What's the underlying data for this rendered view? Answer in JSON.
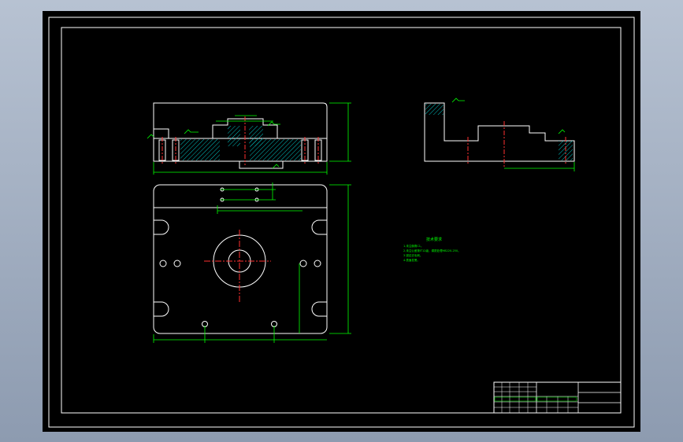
{
  "colors": {
    "background": "#000000",
    "outline": "#ffffff",
    "dimension": "#00ff00",
    "hatch": "#00c0c0",
    "center": "#ff3030"
  },
  "drawing": {
    "tech_requirements_title": "技术要求",
    "tech_requirements": [
      "1.未注倒角C1。",
      "2.未注公差按IT12级，调质处理HB220-250。",
      "3.锐边去毛刺。",
      "4.表面发黑。"
    ],
    "title_block_label": "标题栏"
  }
}
